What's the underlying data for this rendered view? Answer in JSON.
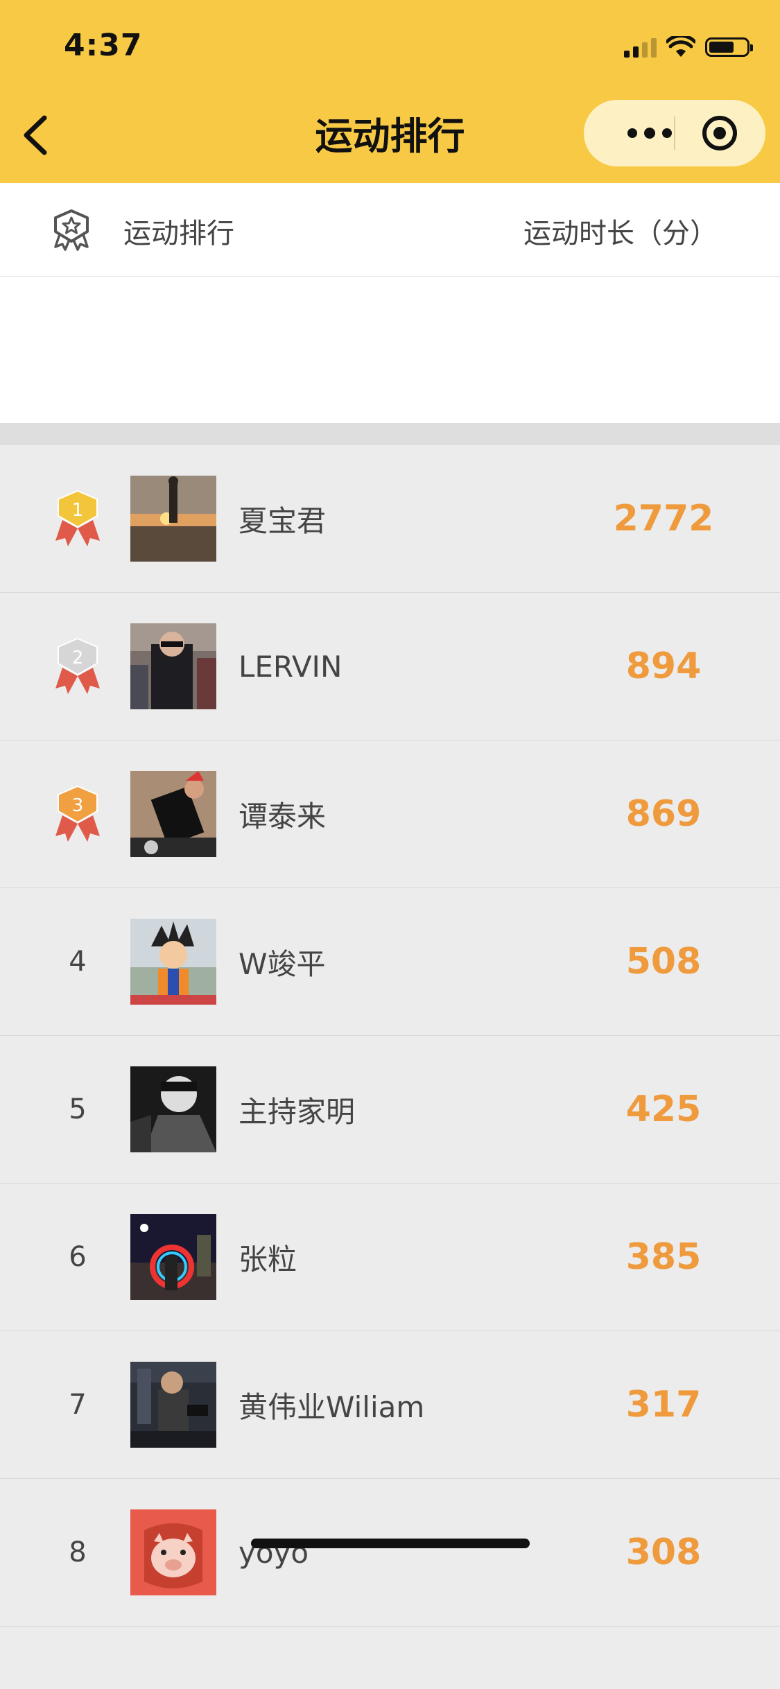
{
  "status_bar": {
    "time": "4:37"
  },
  "nav": {
    "title": "运动排行",
    "back_icon": "chevron-left-icon",
    "more_icon": "more-dots-icon",
    "close_icon": "target-icon"
  },
  "header": {
    "left_label": "运动排行",
    "right_label": "运动时长（分）",
    "icon": "rank-badge-icon"
  },
  "colors": {
    "nav_bg": "#f7c944",
    "score": "#ef9a3c",
    "gold": "#f3c53a",
    "silver": "#d6d6d6",
    "bronze": "#f0a040",
    "ribbon": "#e05a4a"
  },
  "ranking": [
    {
      "rank": "1",
      "medal": "gold",
      "name": "夏宝君",
      "minutes": "2772",
      "avatar": "sunset-silhouette"
    },
    {
      "rank": "2",
      "medal": "silver",
      "name": "LERVIN",
      "minutes": "894",
      "avatar": "street-photo"
    },
    {
      "rank": "3",
      "medal": "bronze",
      "name": "谭泰来",
      "minutes": "869",
      "avatar": "dark-pose"
    },
    {
      "rank": "4",
      "medal": null,
      "name": "W竣平",
      "minutes": "508",
      "avatar": "cartoon"
    },
    {
      "rank": "5",
      "medal": null,
      "name": "主持家明",
      "minutes": "425",
      "avatar": "black-white"
    },
    {
      "rank": "6",
      "medal": null,
      "name": "张粒",
      "minutes": "385",
      "avatar": "night-street"
    },
    {
      "rank": "7",
      "medal": null,
      "name": "黄伟业Wiliam",
      "minutes": "317",
      "avatar": "gym"
    },
    {
      "rank": "8",
      "medal": null,
      "name": "yoyo",
      "minutes": "308",
      "avatar": "pig"
    }
  ]
}
